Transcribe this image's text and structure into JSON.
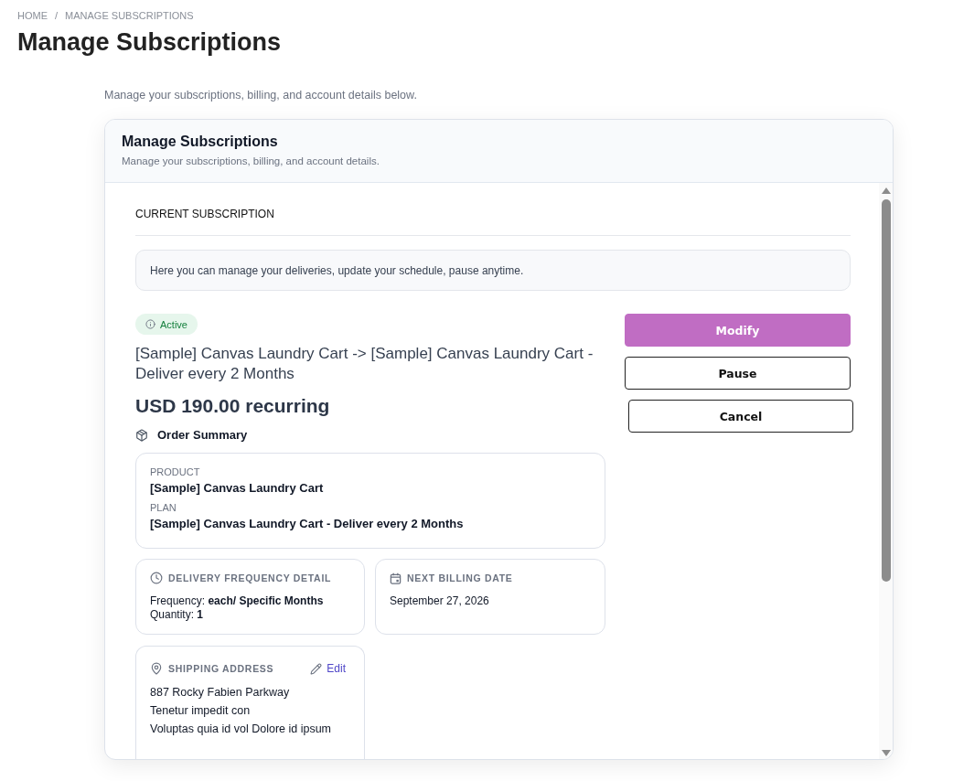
{
  "breadcrumb": {
    "items": [
      {
        "label": "HOME"
      },
      {
        "label": "MANAGE SUBSCRIPTIONS"
      }
    ],
    "separator": "/"
  },
  "page": {
    "title": "Manage Subscriptions",
    "subtitle": "Manage your subscriptions, billing, and account details below."
  },
  "card": {
    "title": "Manage Subscriptions",
    "subtitle": "Manage your subscriptions, billing, and account details."
  },
  "section": {
    "heading": "CURRENT SUBSCRIPTION",
    "notice": "Here you can manage your deliveries, update your schedule, pause anytime."
  },
  "subscription": {
    "status": {
      "label": "Active",
      "kind": "success"
    },
    "title": "[Sample] Canvas Laundry Cart -> [Sample] Canvas Laundry Cart - Deliver every 2 Months",
    "price": "USD 190.00 recurring"
  },
  "order_summary": {
    "heading": "Order Summary",
    "fields": [
      {
        "label": "PRODUCT",
        "value": "[Sample] Canvas Laundry Cart"
      },
      {
        "label": "PLAN",
        "value": "[Sample] Canvas Laundry Cart - Deliver every 2 Months"
      }
    ]
  },
  "delivery": {
    "heading": "DELIVERY FREQUENCY DETAIL",
    "lines": [
      "Frequency: **each/ Specific Months**",
      "Quantity: **1**"
    ]
  },
  "billing": {
    "heading": "NEXT BILLING DATE",
    "date": "September 27, 2026"
  },
  "shipping": {
    "heading": "SHIPPING ADDRESS",
    "edit_label": "Edit",
    "lines": [
      "887 Rocky Fabien Parkway",
      "Tenetur impedit con",
      "Voluptas quia id vol Dolore id ipsum"
    ]
  },
  "actions": [
    {
      "label": "Modify",
      "kind": "primary"
    },
    {
      "label": "Pause",
      "kind": "outline"
    },
    {
      "label": "Cancel",
      "kind": "outline"
    }
  ]
}
